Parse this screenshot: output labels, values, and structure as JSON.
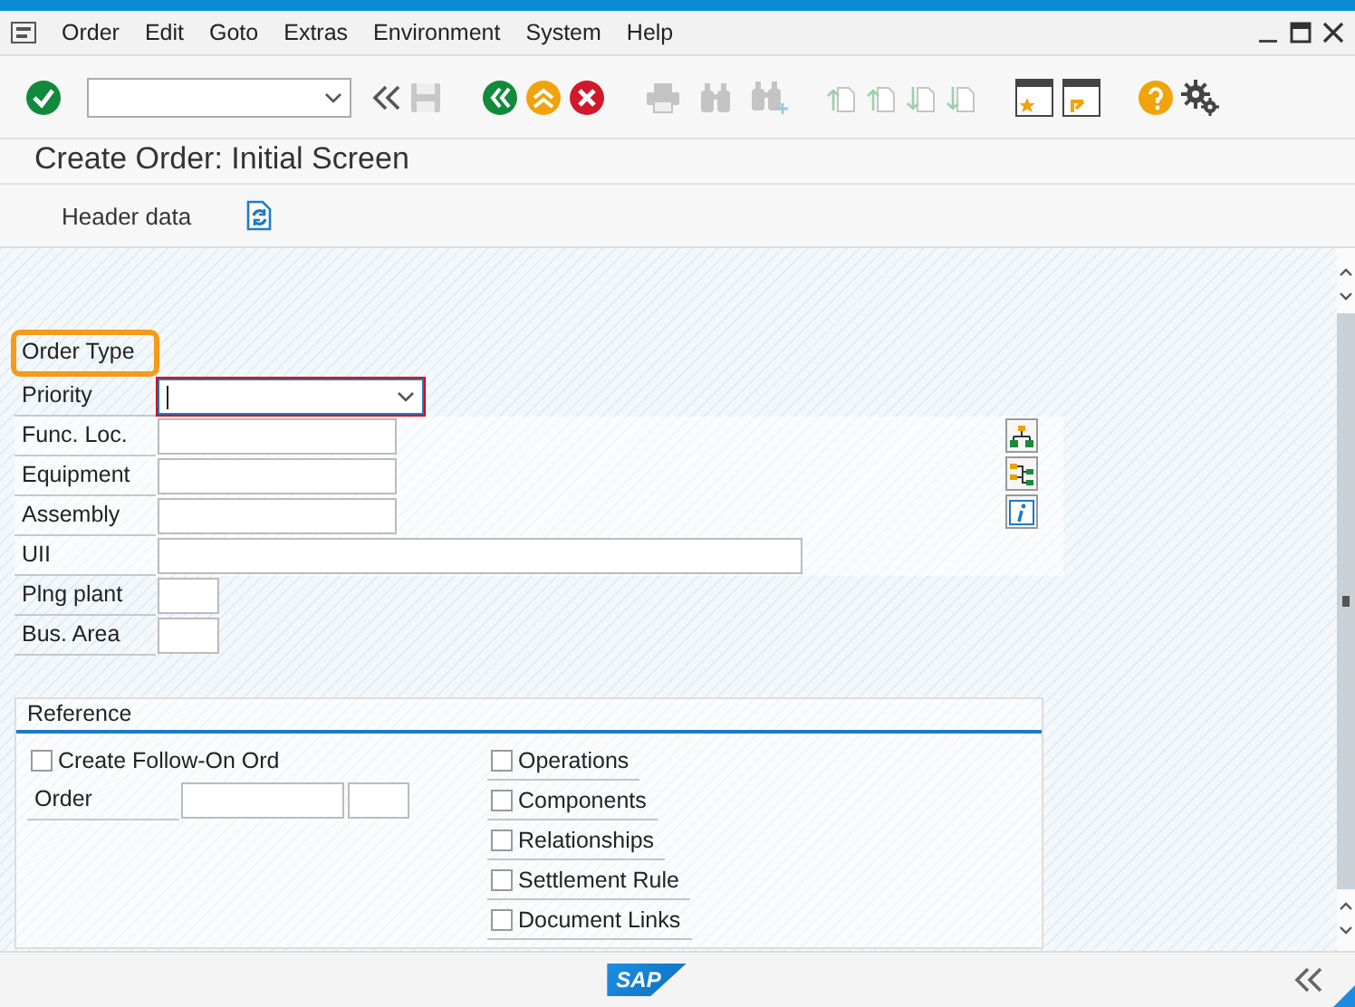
{
  "menu_bar": {
    "items": [
      "Order",
      "Edit",
      "Goto",
      "Extras",
      "Environment",
      "System",
      "Help"
    ]
  },
  "title": "Create Order: Initial Screen",
  "app_toolbar": {
    "items": [
      {
        "label": "Header data"
      }
    ]
  },
  "form": {
    "fields": [
      {
        "label": "Order Type",
        "kind": "none",
        "highlighted": true
      },
      {
        "label": "Priority",
        "kind": "dropdown",
        "focused": true
      },
      {
        "label": "Func. Loc.",
        "kind": "medium"
      },
      {
        "label": "Equipment",
        "kind": "medium"
      },
      {
        "label": "Assembly",
        "kind": "medium"
      },
      {
        "label": "UII",
        "kind": "long"
      },
      {
        "label": "Plng plant",
        "kind": "short"
      },
      {
        "label": "Bus. Area",
        "kind": "short"
      }
    ]
  },
  "reference": {
    "title": "Reference",
    "follow_on": {
      "label": "Create Follow-On Ord",
      "checked": false
    },
    "order_label": "Order",
    "options": [
      {
        "label": "Operations",
        "checked": false
      },
      {
        "label": "Components",
        "checked": false
      },
      {
        "label": "Relationships",
        "checked": false
      },
      {
        "label": "Settlement Rule",
        "checked": false
      },
      {
        "label": "Document Links",
        "checked": false
      }
    ]
  },
  "status_bar": {
    "logo": "SAP"
  }
}
